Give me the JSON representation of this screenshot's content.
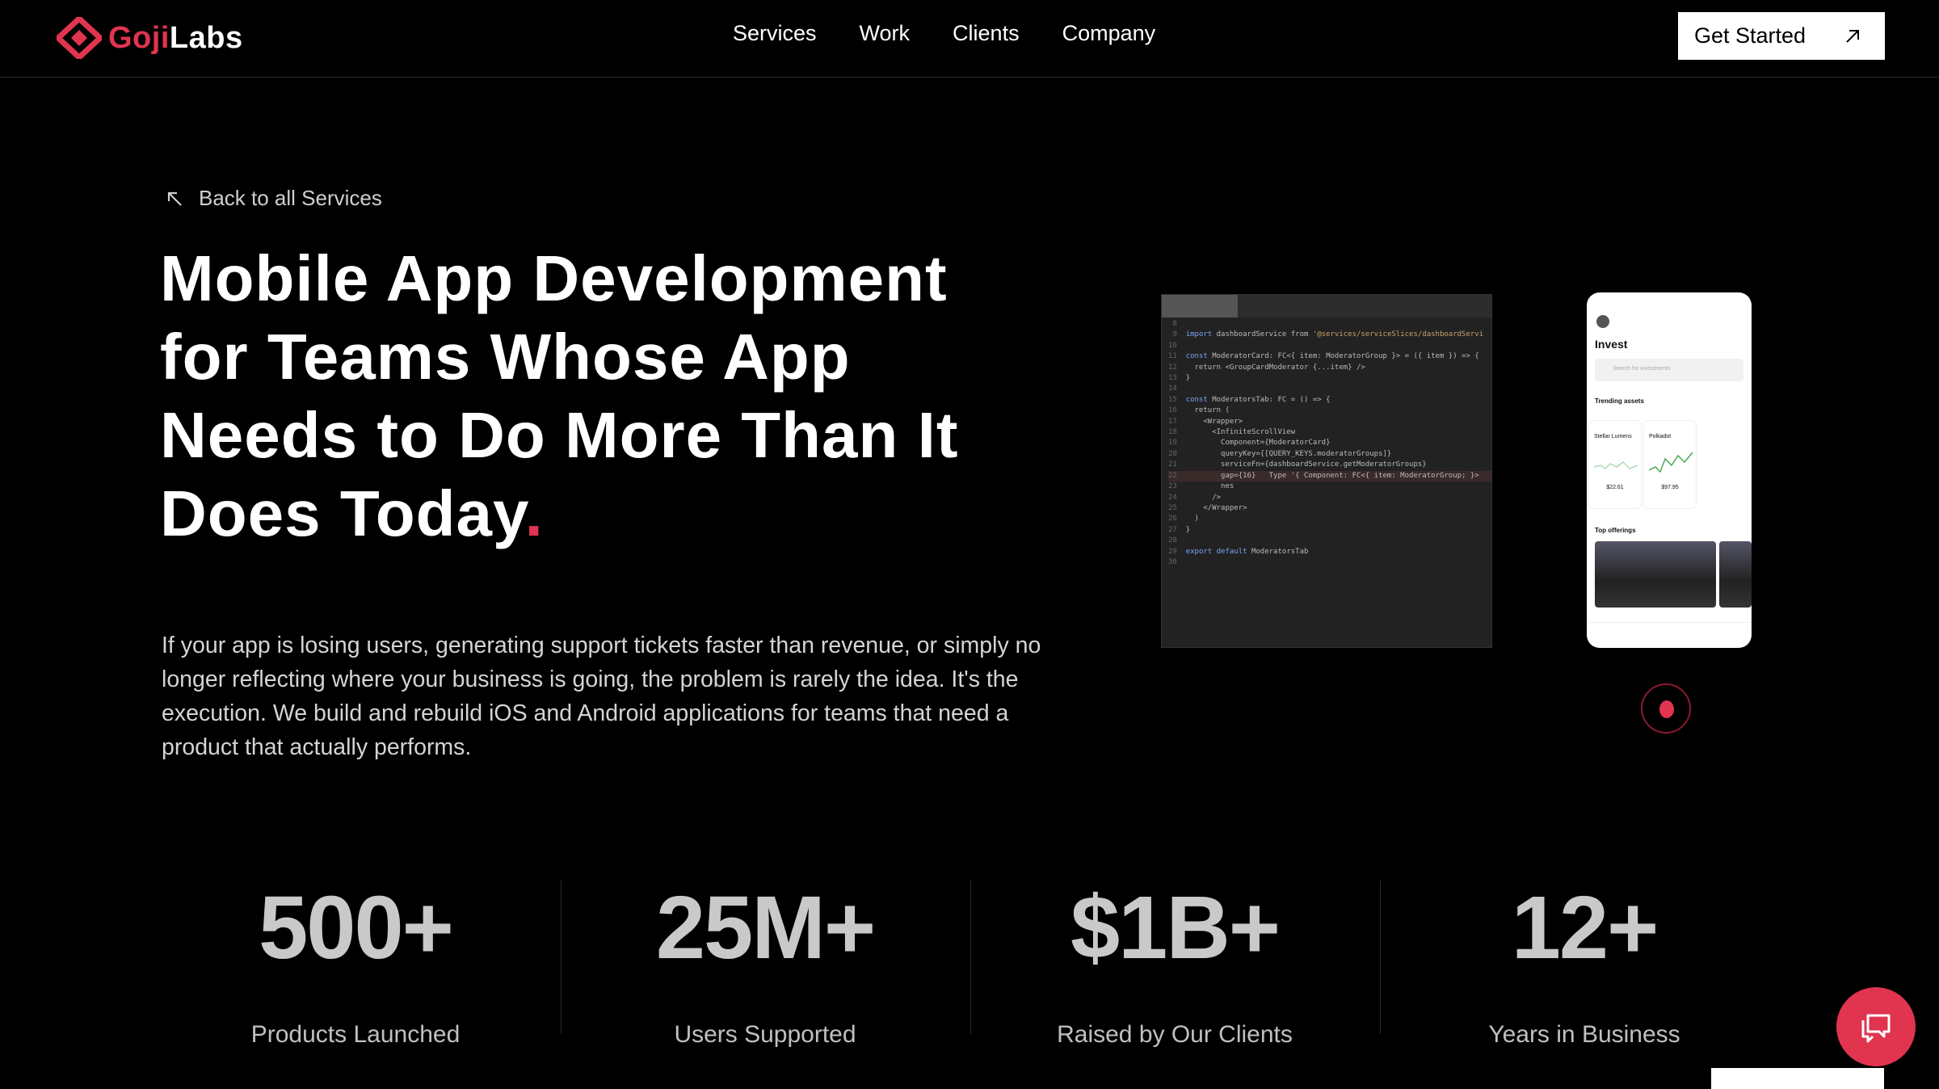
{
  "brand": {
    "name_part1": "Goji",
    "name_part2": "Labs",
    "accent": "#e0344f"
  },
  "nav": {
    "items": [
      "Services",
      "Work",
      "Clients",
      "Company"
    ]
  },
  "cta": {
    "label": "Get Started",
    "icon": "arrow-up-right-icon"
  },
  "hero": {
    "back_label": "Back to all Services",
    "title": "Mobile App Development for Teams Whose App Needs to Do More Than It Does Today",
    "title_dot": ".",
    "description": "If your app is losing users, generating support tickets faster than revenue, or simply no longer reflecting where your business is going, the problem is rarely the idea. It's the execution. We build and rebuild iOS and Android applications for teams that need a product that actually performs."
  },
  "phone_mock": {
    "title": "Invest",
    "search_placeholder": "Search for investments",
    "trending_label": "Trending assets",
    "asset1_name": "Stellar Lumens",
    "asset1_price": "$22.61",
    "asset2_name": "Polkadot",
    "asset2_price": "$97.95",
    "offerings_label": "Top offerings"
  },
  "stats": [
    {
      "value": "500+",
      "label": "Products Launched"
    },
    {
      "value": "25M+",
      "label": "Users Supported"
    },
    {
      "value": "$1B+",
      "label": "Raised by Our Clients"
    },
    {
      "value": "12+",
      "label": "Years in Business"
    }
  ],
  "chat": {
    "icon": "chat-bubble-icon"
  }
}
